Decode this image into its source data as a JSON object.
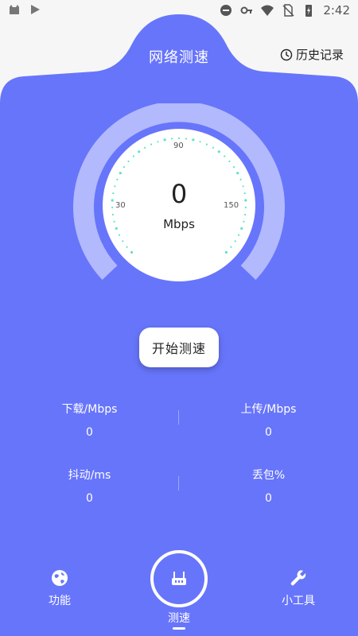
{
  "status_bar": {
    "time": "2:42",
    "left_icons": [
      "cat-icon",
      "play-store-icon"
    ],
    "right_icons": [
      "dnd-icon",
      "key-icon",
      "wifi-icon",
      "no-sim-icon",
      "battery-icon"
    ]
  },
  "header": {
    "title": "网络测速",
    "history_label": "历史记录"
  },
  "gauge": {
    "value": "0",
    "unit": "Mbps",
    "tick_labels": {
      "left": "30",
      "top": "90",
      "right": "150"
    }
  },
  "start_button": {
    "label": "开始测速"
  },
  "stats": {
    "download": {
      "label": "下载/Mbps",
      "value": "0"
    },
    "upload": {
      "label": "上传/Mbps",
      "value": "0"
    },
    "jitter": {
      "label": "抖动/ms",
      "value": "0"
    },
    "loss": {
      "label": "丢包%",
      "value": "0"
    }
  },
  "nav": {
    "features": {
      "label": "功能",
      "icon": "globe-icon"
    },
    "speedtest": {
      "label": "测速",
      "icon": "router-icon"
    },
    "tools": {
      "label": "小工具",
      "icon": "wrench-icon"
    }
  },
  "colors": {
    "primary": "#6775fb",
    "gauge_ring": "#b2b9fc",
    "tick": "#5de3c9",
    "surface": "#f6f6f6"
  }
}
